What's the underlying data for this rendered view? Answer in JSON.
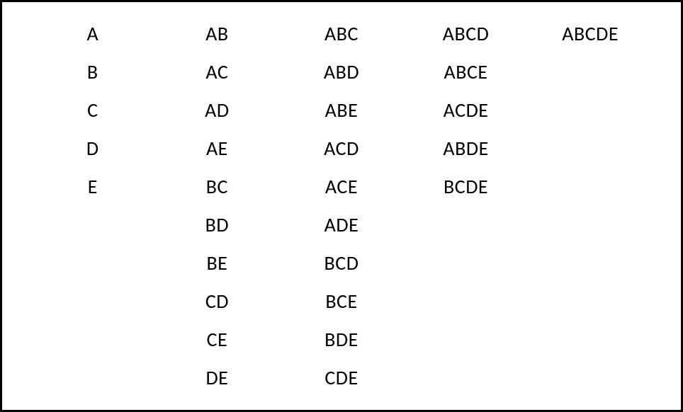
{
  "columns": [
    {
      "items": [
        "A",
        "B",
        "C",
        "D",
        "E"
      ]
    },
    {
      "items": [
        "AB",
        "AC",
        "AD",
        "AE",
        "BC",
        "BD",
        "BE",
        "CD",
        "CE",
        "DE"
      ]
    },
    {
      "items": [
        "ABC",
        "ABD",
        "ABE",
        "ACD",
        "ACE",
        "ADE",
        "BCD",
        "BCE",
        "BDE",
        "CDE"
      ]
    },
    {
      "items": [
        "ABCD",
        "ABCE",
        "ACDE",
        "ABDE",
        "BCDE"
      ]
    },
    {
      "items": [
        "ABCDE"
      ]
    }
  ]
}
